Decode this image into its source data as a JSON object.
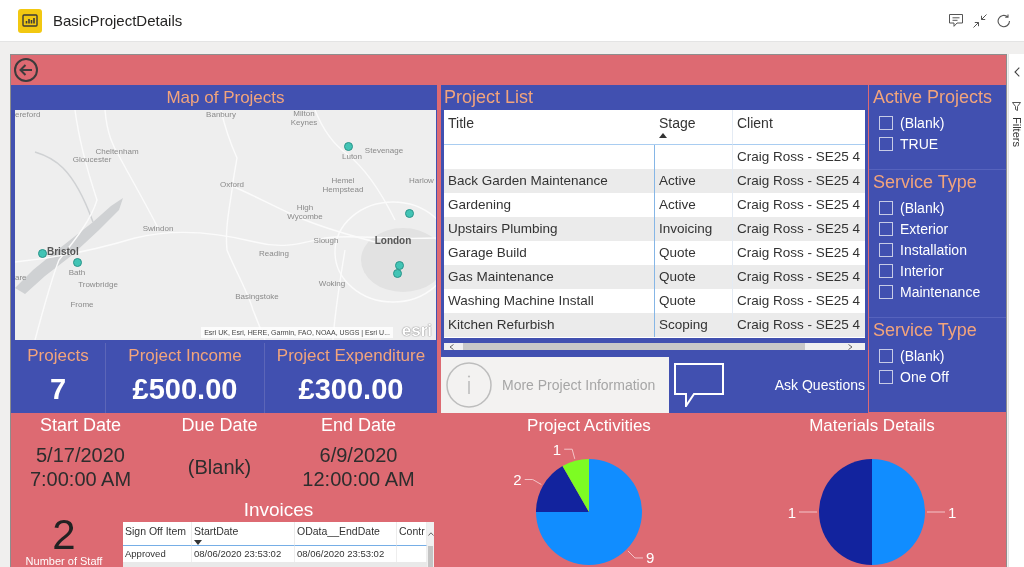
{
  "app_bar": {
    "title": "BasicProjectDetails"
  },
  "map_panel": {
    "title": "Map of Projects",
    "places": [
      {
        "name": "ereford",
        "major": false
      },
      {
        "name": "Banbury",
        "major": false
      },
      {
        "name": "Milton Keynes",
        "major": false
      },
      {
        "name": "Cheltenham",
        "major": false
      },
      {
        "name": "Stevenage",
        "major": false
      },
      {
        "name": "Luton",
        "major": false
      },
      {
        "name": "Gloucester",
        "major": false
      },
      {
        "name": "Harlow",
        "major": false
      },
      {
        "name": "Oxford",
        "major": false
      },
      {
        "name": "Hemel Hempstead",
        "major": false
      },
      {
        "name": "High Wycombe",
        "major": false
      },
      {
        "name": "Swindon",
        "major": false
      },
      {
        "name": "Slough",
        "major": false
      },
      {
        "name": "London",
        "major": true
      },
      {
        "name": "Bristol",
        "major": true
      },
      {
        "name": "Reading",
        "major": false
      },
      {
        "name": "Bath",
        "major": false
      },
      {
        "name": "are",
        "major": false
      },
      {
        "name": "Woking",
        "major": false
      },
      {
        "name": "Trowbridge",
        "major": false
      },
      {
        "name": "Basingstoke",
        "major": false
      },
      {
        "name": "Frome",
        "major": false
      }
    ],
    "attribution": "Esri UK, Esri, HERE, Garmin, FAO, NOAA, USGS | Esri U...",
    "logo": "esri"
  },
  "project_list": {
    "title": "Project List",
    "columns": [
      {
        "label": "Title",
        "sorted": false
      },
      {
        "label": "Stage",
        "sorted": true,
        "ascending": true
      },
      {
        "label": "Client",
        "sorted": false
      }
    ],
    "rows": [
      {
        "client": "Craig Ross - SE25 4"
      },
      {
        "title": "Back Garden Maintenance",
        "stage": "Active",
        "client": "Craig Ross - SE25 4"
      },
      {
        "title": "Gardening",
        "stage": "Active",
        "client": "Craig Ross - SE25 4"
      },
      {
        "title": "Upstairs Plumbing",
        "stage": "Invoicing",
        "client": "Craig Ross - SE25 4"
      },
      {
        "title": "Garage Build",
        "stage": "Quote",
        "client": "Craig Ross - SE25 4"
      },
      {
        "title": "Gas Maintenance",
        "stage": "Quote",
        "client": "Craig Ross - SE25 4"
      },
      {
        "title": "Washing Machine Install",
        "stage": "Quote",
        "client": "Craig Ross - SE25 4"
      },
      {
        "title": "Kitchen Refurbish",
        "stage": "Scoping",
        "client": "Craig Ross - SE25 4"
      }
    ]
  },
  "slicers": [
    {
      "title": "Active Projects",
      "items": [
        {
          "label": "(Blank)",
          "checked": false
        },
        {
          "label": "TRUE",
          "checked": false
        }
      ]
    },
    {
      "title": "Service Type",
      "items": [
        {
          "label": "(Blank)",
          "checked": false
        },
        {
          "label": "Exterior",
          "checked": false
        },
        {
          "label": "Installation",
          "checked": false
        },
        {
          "label": "Interior",
          "checked": false
        },
        {
          "label": "Maintenance",
          "checked": false
        }
      ]
    },
    {
      "title": "Service Type",
      "items": [
        {
          "label": "(Blank)",
          "checked": false
        },
        {
          "label": "One Off",
          "checked": false
        }
      ]
    }
  ],
  "kpis": [
    {
      "label": "Projects",
      "value": "7"
    },
    {
      "label": "Project Income",
      "value": "£500.00"
    },
    {
      "label": "Project Expenditure",
      "value": "£300.00"
    }
  ],
  "buttons": [
    {
      "label": "More Project Information",
      "kind": "info",
      "disabled": true
    },
    {
      "label": "Ask Questions",
      "kind": "question",
      "disabled": false
    }
  ],
  "dates": [
    {
      "label": "Start Date",
      "lines": [
        "5/17/2020",
        "7:00:00 AM"
      ]
    },
    {
      "label": "Due Date",
      "lines": [
        "(Blank)"
      ]
    },
    {
      "label": "End Date",
      "lines": [
        "6/9/2020",
        "12:00:00 AM"
      ]
    }
  ],
  "staff": {
    "value": "2",
    "label": "Number of Staff"
  },
  "invoices": {
    "title": "Invoices",
    "columns": [
      {
        "label": "Sign Off Item",
        "sorted": false
      },
      {
        "label": "StartDate",
        "sorted": true,
        "ascending": false
      },
      {
        "label": "OData__EndDate",
        "sorted": false
      },
      {
        "label": "Contr",
        "sorted": false
      }
    ],
    "rows": [
      {
        "cells": [
          "Approved",
          "08/06/2020 23:53:02",
          "08/06/2020 23:53:02"
        ]
      }
    ]
  },
  "charts": [
    {
      "chart_data": {
        "type": "pie",
        "title": "Project Activities",
        "values": [
          9,
          2,
          1
        ],
        "data_labels": true
      }
    },
    {
      "chart_data": {
        "type": "pie",
        "title": "Materials Details",
        "values": [
          1,
          1
        ],
        "data_labels": true
      }
    }
  ],
  "filters_pane": {
    "label": "Filters"
  }
}
